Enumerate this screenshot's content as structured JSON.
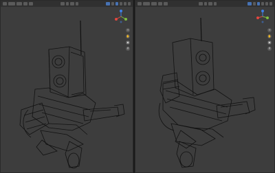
{
  "left_viewport": {
    "header": {
      "mode_label": "",
      "shading": "wireframe"
    },
    "corner_hint": ""
  },
  "right_viewport": {
    "header": {
      "mode_label": "",
      "shading": "wireframe"
    },
    "corner_hint": ""
  },
  "gizmo": {
    "x_color": "#e5473f",
    "y_color": "#7fbf3f",
    "z_color": "#3f7fe5"
  },
  "nav_icons": [
    "zoom-icon",
    "hand-icon",
    "camera-icon",
    "grid-icon"
  ],
  "colors": {
    "viewport_bg": "#3d3d3d",
    "wire": "#111111"
  }
}
